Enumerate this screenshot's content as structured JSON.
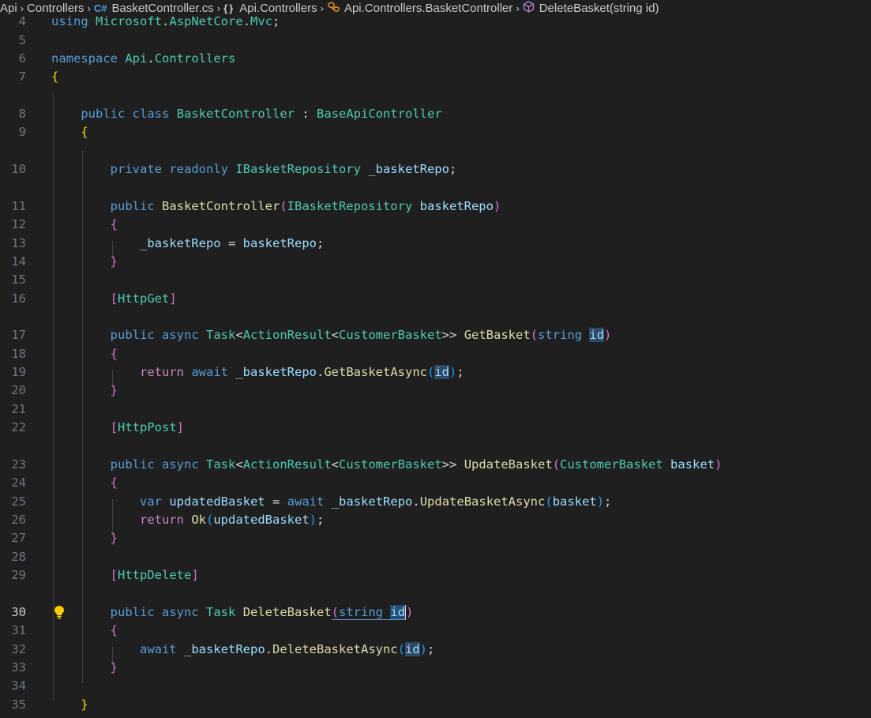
{
  "breadcrumb": {
    "items": [
      "Api",
      "Controllers",
      "BasketController.cs",
      "Api.Controllers",
      "Api.Controllers.BasketController",
      "DeleteBasket(string id)"
    ],
    "file_icon": "C#",
    "namespace_icon": "{}"
  },
  "editor": {
    "active_line": "30",
    "lines": [
      {
        "num": "4"
      },
      {
        "num": "5"
      },
      {
        "num": "6"
      },
      {
        "num": "7"
      },
      {
        "num": "8"
      },
      {
        "num": "9"
      },
      {
        "num": "10"
      },
      {
        "num": "11"
      },
      {
        "num": "12"
      },
      {
        "num": "13"
      },
      {
        "num": "14"
      },
      {
        "num": "15"
      },
      {
        "num": "16"
      },
      {
        "num": "17"
      },
      {
        "num": "18"
      },
      {
        "num": "19"
      },
      {
        "num": "20"
      },
      {
        "num": "21"
      },
      {
        "num": "22"
      },
      {
        "num": "23"
      },
      {
        "num": "24"
      },
      {
        "num": "25"
      },
      {
        "num": "26"
      },
      {
        "num": "27"
      },
      {
        "num": "28"
      },
      {
        "num": "29"
      },
      {
        "num": "30"
      },
      {
        "num": "31"
      },
      {
        "num": "32"
      },
      {
        "num": "33"
      },
      {
        "num": "34"
      },
      {
        "num": "35"
      }
    ],
    "tokens": {
      "l4": [
        "using",
        "Microsoft",
        ".",
        "AspNetCore",
        ".",
        "Mvc",
        ";"
      ],
      "l6": [
        "namespace",
        "Api",
        ".",
        "Controllers"
      ],
      "l7": [
        "{"
      ],
      "l8": [
        "public",
        "class",
        "BasketController",
        ":",
        "BaseApiController"
      ],
      "l9": [
        "{"
      ],
      "l10": [
        "private",
        "readonly",
        "IBasketRepository",
        "_basketRepo",
        ";"
      ],
      "l11": [
        "public",
        "BasketController",
        "(",
        "IBasketRepository",
        "basketRepo",
        ")"
      ],
      "l12": [
        "{"
      ],
      "l13": [
        "_basketRepo",
        "=",
        "basketRepo",
        ";"
      ],
      "l14": [
        "}"
      ],
      "l16": [
        "[",
        "HttpGet",
        "]"
      ],
      "l17": [
        "public",
        "async",
        "Task",
        "<",
        "ActionResult",
        "<",
        "CustomerBasket",
        ">>",
        "GetBasket",
        "(",
        "string",
        "id",
        ")"
      ],
      "l18": [
        "{"
      ],
      "l19": [
        "return",
        "await",
        "_basketRepo",
        ".",
        "GetBasketAsync",
        "(",
        "id",
        ")",
        ";"
      ],
      "l20": [
        "}"
      ],
      "l22": [
        "[",
        "HttpPost",
        "]"
      ],
      "l23": [
        "public",
        "async",
        "Task",
        "<",
        "ActionResult",
        "<",
        "CustomerBasket",
        ">>",
        "UpdateBasket",
        "(",
        "CustomerBasket",
        "basket",
        ")"
      ],
      "l24": [
        "{"
      ],
      "l25": [
        "var",
        "updatedBasket",
        "=",
        "await",
        "_basketRepo",
        ".",
        "UpdateBasketAsync",
        "(",
        "basket",
        ")",
        ";"
      ],
      "l26": [
        "return",
        "Ok",
        "(",
        "updatedBasket",
        ")",
        ";"
      ],
      "l27": [
        "}"
      ],
      "l29": [
        "[",
        "HttpDelete",
        "]"
      ],
      "l30": [
        "public",
        "async",
        "Task",
        "DeleteBasket",
        "(",
        "string",
        "id",
        ")"
      ],
      "l31": [
        "{"
      ],
      "l32": [
        "await",
        "_basketRepo",
        ".",
        "DeleteBasketAsync",
        "(",
        "id",
        ")",
        ";"
      ],
      "l33": [
        "}"
      ],
      "l35": [
        "}"
      ]
    }
  },
  "colors": {
    "background": "#1f1f1f",
    "keyword": "#569cd6",
    "control": "#c586c0",
    "type": "#4ec9b0",
    "function": "#dcdcaa",
    "variable": "#9cdcfe",
    "bracket1": "#ffd700",
    "bracket2": "#da70d6",
    "bracket3": "#179fff",
    "lightbulb": "#ffcc00"
  }
}
